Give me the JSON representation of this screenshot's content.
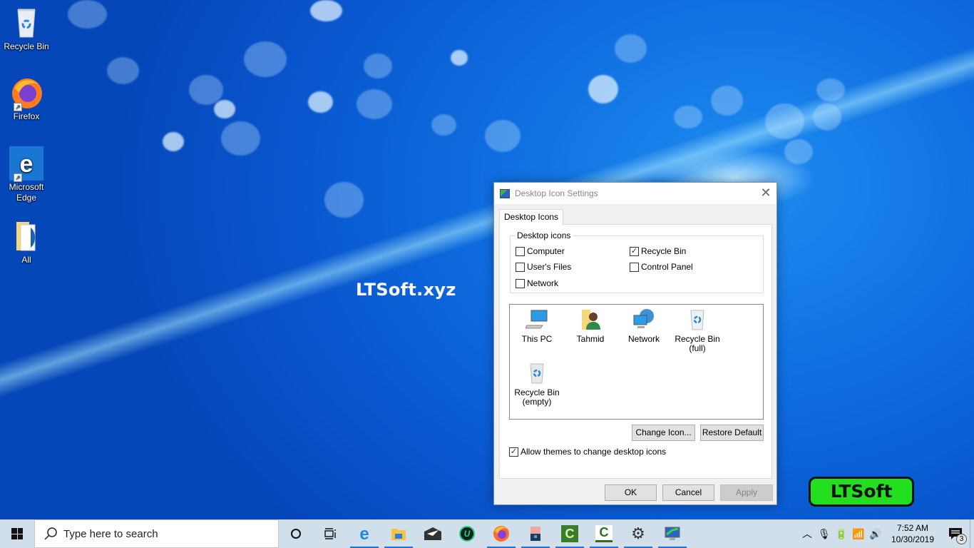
{
  "desktop": {
    "icons": [
      {
        "label": "Recycle Bin",
        "icon": "recycle-bin-icon",
        "shortcut": false
      },
      {
        "label": "Firefox",
        "icon": "firefox-icon",
        "shortcut": true
      },
      {
        "label": "Microsoft Edge",
        "icon": "edge-icon",
        "shortcut": true
      },
      {
        "label": "All",
        "icon": "folder-icon",
        "shortcut": false
      }
    ],
    "watermark": "LTSoft.xyz",
    "logo_badge": "LTSoft",
    "colors": {
      "badge_green": "#22e01e",
      "desktop_blue": "#0f6ee0"
    }
  },
  "dialog": {
    "title": "Desktop Icon Settings",
    "close_glyph": "✕",
    "tab": "Desktop Icons",
    "group_label": "Desktop icons",
    "checkboxes": [
      {
        "label": "Computer",
        "checked": false
      },
      {
        "label": "User's Files",
        "checked": false
      },
      {
        "label": "Network",
        "checked": false
      },
      {
        "label": "Recycle Bin",
        "checked": true
      },
      {
        "label": "Control Panel",
        "checked": false
      }
    ],
    "icon_list": [
      {
        "label": "This PC",
        "icon": "this-pc-icon"
      },
      {
        "label": "Tahmid",
        "icon": "user-folder-icon"
      },
      {
        "label": "Network",
        "icon": "network-icon"
      },
      {
        "label": "Recycle Bin (full)",
        "line1": "Recycle Bin",
        "line2": "(full)",
        "icon": "recycle-bin-full-icon"
      },
      {
        "label": "Recycle Bin (empty)",
        "line1": "Recycle Bin",
        "line2": "(empty)",
        "icon": "recycle-bin-empty-icon"
      }
    ],
    "change_icon_label": "Change Icon...",
    "restore_default_label": "Restore Default",
    "allow_themes_label": "Allow themes to change desktop icons",
    "allow_themes_checked": true,
    "ok_label": "OK",
    "cancel_label": "Cancel",
    "apply_label": "Apply",
    "apply_enabled": false
  },
  "taskbar": {
    "search_placeholder": "Type here to search",
    "pinned": [
      {
        "name": "edge",
        "icon": "edge-icon",
        "active": true
      },
      {
        "name": "file-explorer",
        "icon": "file-explorer-icon",
        "active": true
      },
      {
        "name": "mail",
        "icon": "mail-icon",
        "active": false
      },
      {
        "name": "iobit-uninstaller",
        "icon": "uninstaller-icon",
        "active": false
      },
      {
        "name": "firefox",
        "icon": "firefox-icon",
        "active": true
      },
      {
        "name": "game",
        "icon": "character-app-icon",
        "active": true
      },
      {
        "name": "camtasia-recorder",
        "icon": "camtasia-icon",
        "active": true
      },
      {
        "name": "camtasia",
        "icon": "camtasia-editor-icon",
        "active": true
      },
      {
        "name": "settings",
        "icon": "gear-icon",
        "active": true
      },
      {
        "name": "display-settings",
        "icon": "display-settings-icon",
        "active": true
      }
    ],
    "time": "7:52 AM",
    "date": "10/30/2019",
    "notification_count": "3",
    "colors": {
      "taskbar_bg": "#d1dfea",
      "active_underline": "#1a73e8"
    }
  }
}
